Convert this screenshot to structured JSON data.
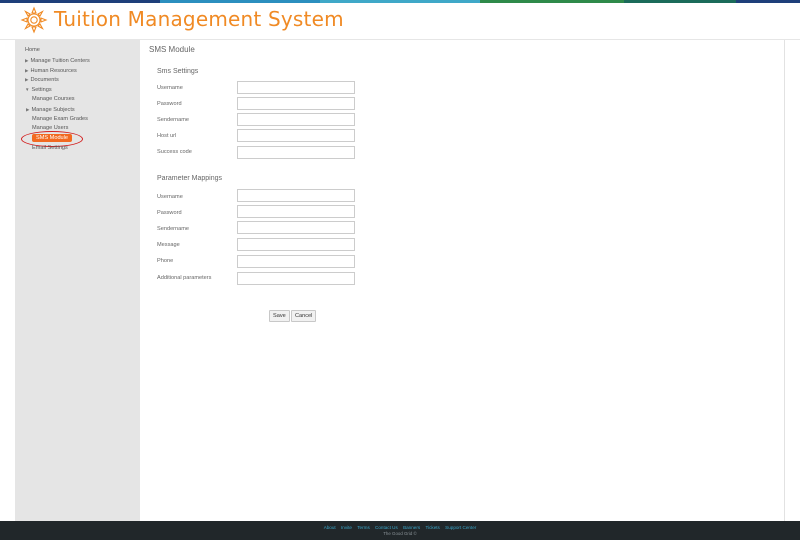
{
  "header": {
    "title": "Tuition Management System",
    "logo_icon": "sunflower-logo-icon"
  },
  "sidebar": {
    "items": [
      {
        "label": "Home"
      },
      {
        "label": "Manage Tuition Centers"
      },
      {
        "label": "Human Resources"
      },
      {
        "label": "Documents"
      },
      {
        "label": "Settings"
      },
      {
        "label": "Manage Courses"
      },
      {
        "label": "Manage Subjects"
      },
      {
        "label": "Manage Exam Grades"
      },
      {
        "label": "Manage Users"
      },
      {
        "label": "SMS Module"
      },
      {
        "label": "Email Settings"
      }
    ]
  },
  "main": {
    "page_title": "SMS Module",
    "sms_settings": {
      "title": "Sms Settings",
      "fields": [
        {
          "label": "Username",
          "value": ""
        },
        {
          "label": "Password",
          "value": ""
        },
        {
          "label": "Sendername",
          "value": ""
        },
        {
          "label": "Host url",
          "value": ""
        },
        {
          "label": "Success code",
          "value": ""
        }
      ]
    },
    "parameter_mappings": {
      "title": "Parameter Mappings",
      "fields": [
        {
          "label": "Username",
          "value": ""
        },
        {
          "label": "Password",
          "value": ""
        },
        {
          "label": "Sendername",
          "value": ""
        },
        {
          "label": "Message",
          "value": ""
        },
        {
          "label": "Phone",
          "value": ""
        },
        {
          "label": "Additional parameters",
          "value": ""
        }
      ]
    },
    "save_label": "Save",
    "cancel_label": "Cancel"
  },
  "footer": {
    "links": [
      "About",
      "Invite",
      "Terms",
      "Contact Us",
      "Banners",
      "Tickets",
      "Support Center"
    ],
    "copyright": "The Good Grid ©"
  },
  "colors": {
    "brand": "#f08a24",
    "active": "#f26a21",
    "highlight": "#d32020",
    "footer_bg": "#21272a",
    "footer_link": "#3aa6c9"
  }
}
